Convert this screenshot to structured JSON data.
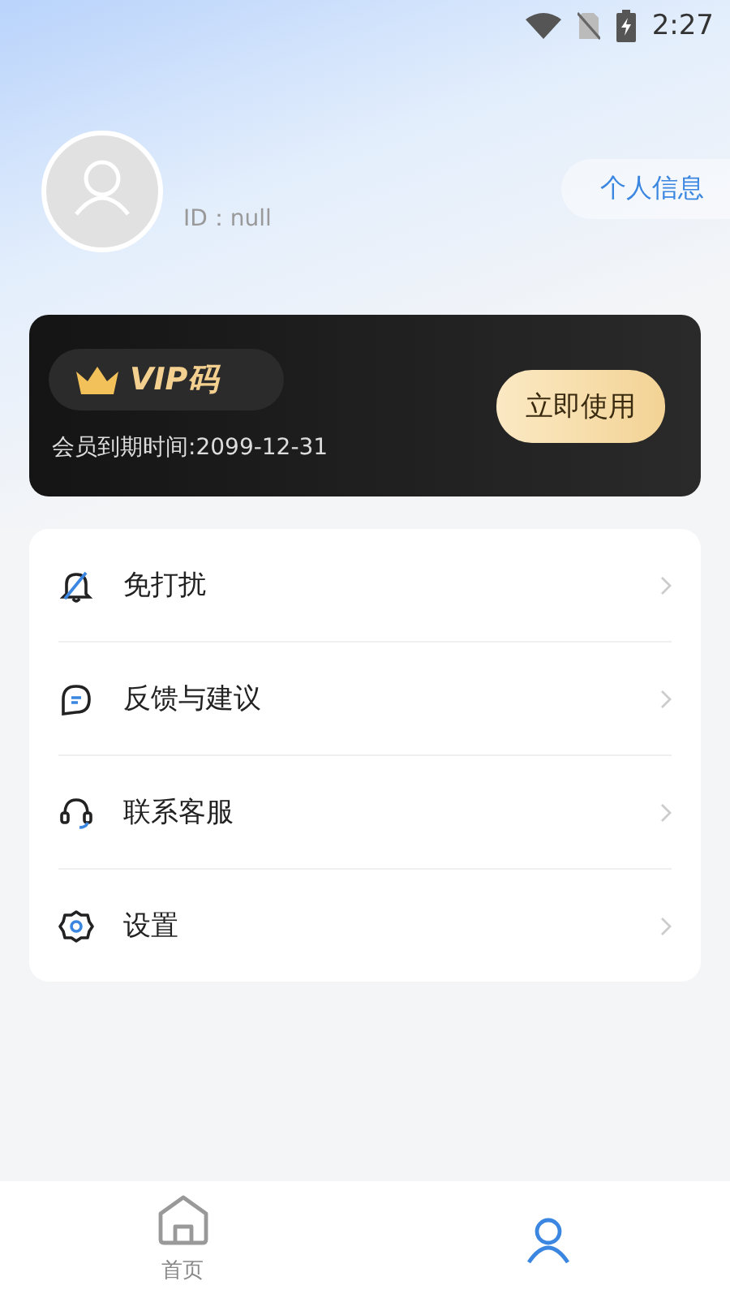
{
  "status_bar": {
    "time": "2:27"
  },
  "profile": {
    "id_text": "ID：null",
    "info_button": "个人信息"
  },
  "vip_card": {
    "title": "VIP码",
    "expiry": "会员到期时间:2099-12-31",
    "button": "立即使用"
  },
  "menu": [
    {
      "label": "免打扰"
    },
    {
      "label": "反馈与建议"
    },
    {
      "label": "联系客服"
    },
    {
      "label": "设置"
    }
  ],
  "tabs": [
    {
      "label": "首页",
      "selected": false
    },
    {
      "selected": true
    }
  ]
}
